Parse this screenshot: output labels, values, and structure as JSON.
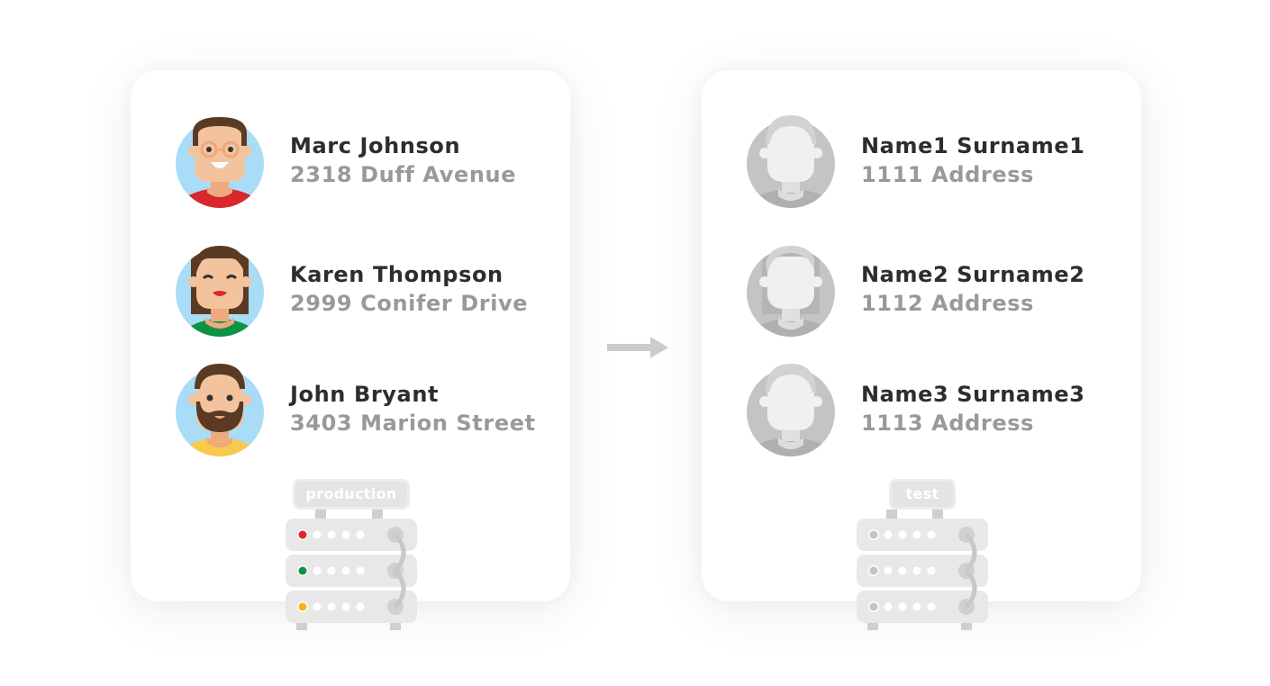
{
  "colors": {
    "name_text": "#2d2d2d",
    "address_text": "#999999",
    "led_red": "#d9272e",
    "led_green": "#0c9344",
    "led_yellow": "#f6b21a",
    "led_gray": "#c4c4c4",
    "avatar_bg": "#a8dcf7",
    "placeholder_avatar": "#c8c8c8"
  },
  "source": {
    "server_label": "production",
    "server_status_leds": [
      "red",
      "green",
      "yellow"
    ],
    "people": [
      {
        "name": "Marc Johnson",
        "address": "2318 Duff Avenue",
        "avatar": "man-glasses-red-shirt"
      },
      {
        "name": "Karen Thompson",
        "address": "2999 Conifer Drive",
        "avatar": "woman-green-shirt"
      },
      {
        "name": "John Bryant",
        "address": "3403 Marion Street",
        "avatar": "man-beard-yellow-shirt"
      }
    ]
  },
  "arrow": {
    "icon": "right-arrow-icon",
    "meaning": "anonymize / copy to"
  },
  "target": {
    "server_label": "test",
    "server_status_leds": [
      "gray",
      "gray",
      "gray"
    ],
    "people": [
      {
        "name": "Name1 Surname1",
        "address": "1111 Address",
        "avatar": "placeholder-male"
      },
      {
        "name": "Name2 Surname2",
        "address": "1112 Address",
        "avatar": "placeholder-female"
      },
      {
        "name": "Name3 Surname3",
        "address": "1113 Address",
        "avatar": "placeholder-male"
      }
    ]
  }
}
